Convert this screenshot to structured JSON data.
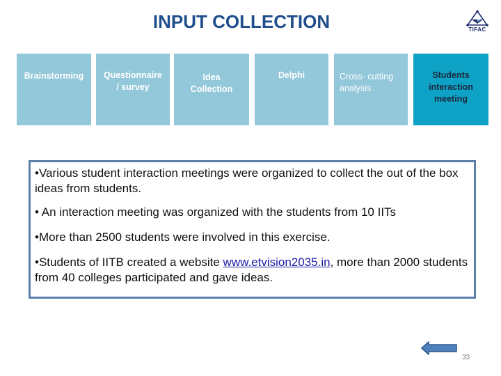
{
  "header": {
    "title": "INPUT COLLECTION",
    "logo_text": "TIFAC",
    "logo_icon": "tifac-triangle-logo"
  },
  "process_steps": [
    {
      "label": "Brainstorming",
      "active": false
    },
    {
      "label": "Questionnaire\n/ survey",
      "active": false
    },
    {
      "label": "Idea\nCollection",
      "active": false
    },
    {
      "label": "Delphi",
      "active": false
    },
    {
      "label": "Cross- cutting\nanalysis",
      "active": false
    },
    {
      "label": "Students\ninteraction\nmeeting",
      "active": true
    }
  ],
  "content": {
    "bullets": [
      {
        "text": "•Various student interaction meetings were organized to collect the out of the box ideas from students."
      },
      {
        "text": "• An interaction meeting was organized with the students from 10 IITs"
      },
      {
        "text": "•More than 2500 students were involved in this exercise."
      },
      {
        "prefix": "•Students of IITB created a website ",
        "link": "www.etvision2035.in",
        "suffix": ", more than 2000 students from 40 colleges participated and gave ideas."
      }
    ]
  },
  "footer": {
    "back_icon": "left-arrow-icon",
    "page_number": "33"
  },
  "colors": {
    "title": "#1f4e8c",
    "step_inactive": "#93c8da",
    "step_active": "#0ea2c6",
    "content_border": "#5a7fa9",
    "link": "#1a1aa6",
    "arrow": "#4f81bd"
  }
}
